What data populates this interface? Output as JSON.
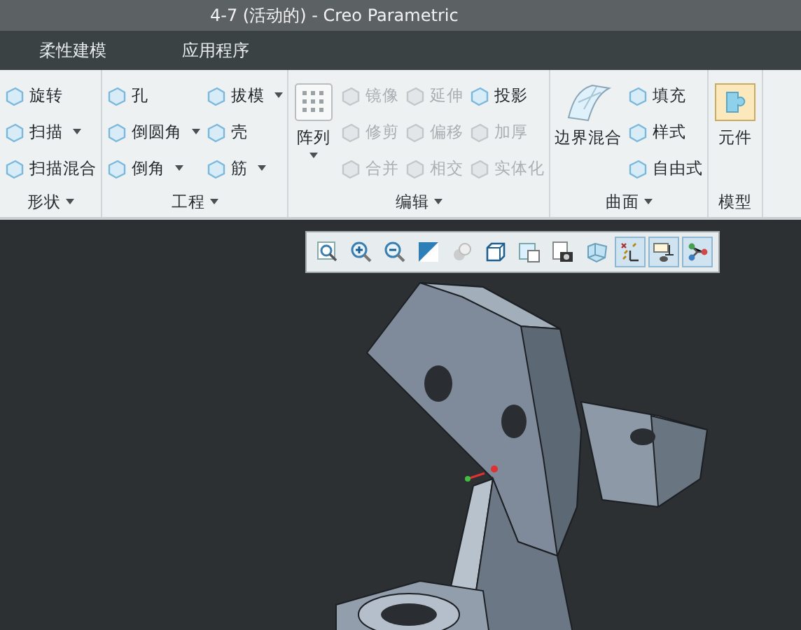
{
  "window": {
    "title": "4-7 (活动的) - Creo Parametric"
  },
  "tabs": [
    {
      "label": "柔性建模",
      "selected": false
    },
    {
      "label": "应用程序",
      "selected": false
    }
  ],
  "ribbon": {
    "groups": [
      {
        "label": "形状",
        "dropdown": true,
        "columns": [
          [
            {
              "label": "旋转",
              "dropdown": false,
              "disabled": false
            },
            {
              "label": "扫描",
              "dropdown": true,
              "disabled": false
            },
            {
              "label": "扫描混合",
              "dropdown": false,
              "disabled": false
            }
          ]
        ]
      },
      {
        "label": "工程",
        "dropdown": true,
        "columns": [
          [
            {
              "label": "孔",
              "dropdown": false,
              "disabled": false
            },
            {
              "label": "倒圆角",
              "dropdown": true,
              "disabled": false
            },
            {
              "label": "倒角",
              "dropdown": true,
              "disabled": false
            }
          ],
          [
            {
              "label": "拔模",
              "dropdown": true,
              "disabled": false
            },
            {
              "label": "壳",
              "dropdown": false,
              "disabled": false
            },
            {
              "label": "筋",
              "dropdown": true,
              "disabled": false
            }
          ]
        ]
      },
      {
        "label": "编辑",
        "dropdown": true,
        "large": {
          "label": "阵列",
          "dropdown": true
        },
        "columns": [
          [
            {
              "label": "镜像",
              "dropdown": false,
              "disabled": true
            },
            {
              "label": "修剪",
              "dropdown": false,
              "disabled": true
            },
            {
              "label": "合并",
              "dropdown": false,
              "disabled": true
            }
          ],
          [
            {
              "label": "延伸",
              "dropdown": false,
              "disabled": true
            },
            {
              "label": "偏移",
              "dropdown": false,
              "disabled": true
            },
            {
              "label": "相交",
              "dropdown": false,
              "disabled": true
            }
          ],
          [
            {
              "label": "投影",
              "dropdown": false,
              "disabled": false
            },
            {
              "label": "加厚",
              "dropdown": false,
              "disabled": true
            },
            {
              "label": "实体化",
              "dropdown": false,
              "disabled": true
            }
          ]
        ]
      },
      {
        "label": "曲面",
        "dropdown": true,
        "large": {
          "label": "边界混合",
          "dropdown": false
        },
        "columns": [
          [
            {
              "label": "填充",
              "dropdown": false,
              "disabled": false
            },
            {
              "label": "样式",
              "dropdown": false,
              "disabled": false
            },
            {
              "label": "自由式",
              "dropdown": false,
              "disabled": false
            }
          ]
        ]
      },
      {
        "label": "模型",
        "dropdown": false,
        "large": {
          "label": "元件",
          "dropdown": false
        }
      }
    ]
  },
  "view_toolbar": [
    {
      "on": false
    },
    {
      "on": false
    },
    {
      "on": false
    },
    {
      "on": false
    },
    {
      "on": false
    },
    {
      "on": false
    },
    {
      "on": false
    },
    {
      "on": false
    },
    {
      "on": false
    },
    {
      "on": true
    },
    {
      "on": true
    },
    {
      "on": true
    }
  ]
}
